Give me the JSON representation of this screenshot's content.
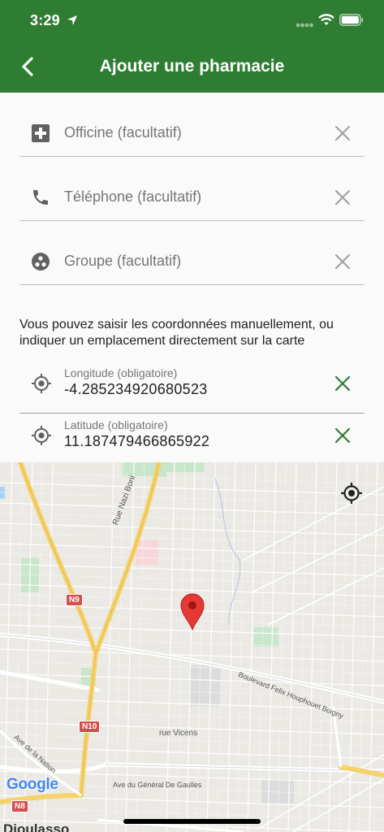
{
  "status_bar": {
    "time": "3:29"
  },
  "header": {
    "title": "Ajouter une pharmacie"
  },
  "form": {
    "officine": {
      "placeholder": "Officine (facultatif)",
      "icon": "local-pharmacy-icon"
    },
    "telephone": {
      "placeholder": "Téléphone (facultatif)",
      "icon": "phone-icon"
    },
    "groupe": {
      "placeholder": "Groupe (facultatif)",
      "icon": "group-work-icon"
    },
    "hint": "Vous pouvez saisir les coordonnées manuellement, ou indiquer un emplacement directement sur la carte",
    "longitude": {
      "label": "Longitude (obligatoire)",
      "value": "-4.285234920680523"
    },
    "latitude": {
      "label": "Latitude (obligatoire)",
      "value": "11.187479466865922"
    }
  },
  "map": {
    "streets": {
      "nazi_boni": "Rue Nazi Boni",
      "felix": "Boulevard Felix Houphouet Boigny",
      "vicens": "rue Vicens",
      "nation": "Ave de la Nation",
      "de_gaulle": "Ave du Général De Gaulles"
    },
    "routes": {
      "n9": "N9",
      "n10": "N10",
      "n8": "N8"
    },
    "attribution": "Google",
    "city": "Dioulasso"
  },
  "colors": {
    "primary": "#2e7d32",
    "accent_clear": "#2e7d32",
    "marker": "#e53935"
  }
}
